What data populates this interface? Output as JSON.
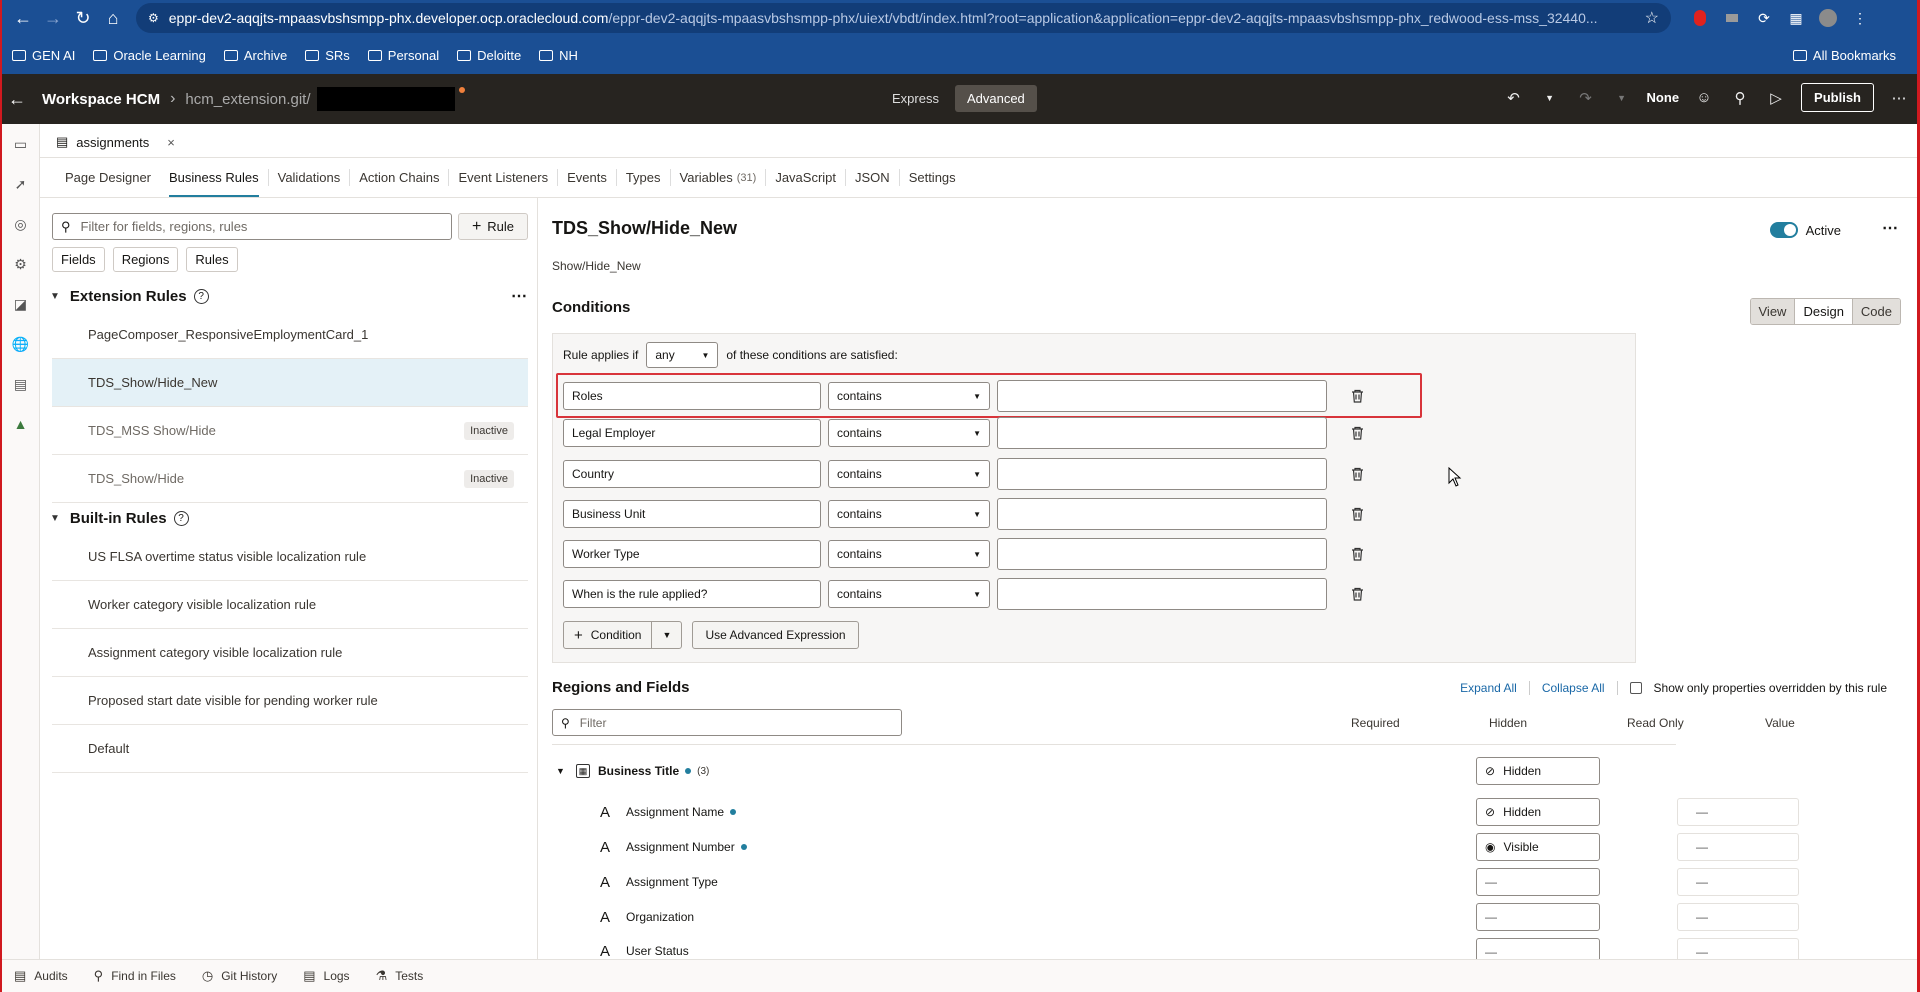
{
  "browser": {
    "url_domain": "eppr-dev2-aqqjts-mpaasvbshsmpp-phx.developer.ocp.oraclecloud.com",
    "url_path": "/eppr-dev2-aqqjts-mpaasvbshsmpp-phx/uiext/vbdt/index.html?root=application&application=eppr-dev2-aqqjts-mpaasvbshsmpp-phx_redwood-ess-mss_32440...",
    "bookmarks": [
      "GEN AI",
      "Oracle Learning",
      "Archive",
      "SRs",
      "Personal",
      "Deloitte",
      "NH"
    ],
    "all_bookmarks": "All Bookmarks"
  },
  "header": {
    "workspace": "Workspace HCM",
    "repo": "hcm_extension.git/",
    "modes": [
      "Express",
      "Advanced"
    ],
    "active_mode": "Advanced",
    "none_label": "None",
    "publish_label": "Publish"
  },
  "file_tab": {
    "label": "assignments",
    "close": "×"
  },
  "sub_tabs": [
    {
      "label": "Page Designer"
    },
    {
      "label": "Business Rules"
    },
    {
      "label": "Validations"
    },
    {
      "label": "Action Chains"
    },
    {
      "label": "Event Listeners"
    },
    {
      "label": "Events"
    },
    {
      "label": "Types"
    },
    {
      "label": "Variables",
      "count": "(31)"
    },
    {
      "label": "JavaScript"
    },
    {
      "label": "JSON"
    },
    {
      "label": "Settings"
    }
  ],
  "left": {
    "search_placeholder": "Filter for fields, regions, rules",
    "rule_button": "Rule",
    "chips": [
      "Fields",
      "Regions",
      "Rules"
    ],
    "extension_title": "Extension Rules",
    "extension_rules": [
      {
        "name": "PageComposer_ResponsiveEmploymentCard_1",
        "badge": ""
      },
      {
        "name": "TDS_Show/Hide_New",
        "badge": ""
      },
      {
        "name": "TDS_MSS Show/Hide",
        "badge": "Inactive"
      },
      {
        "name": "TDS_Show/Hide",
        "badge": "Inactive"
      }
    ],
    "builtin_title": "Built-in Rules",
    "builtin_rules": [
      "US FLSA overtime status visible localization rule",
      "Worker category visible localization rule",
      "Assignment category visible localization rule",
      "Proposed start date visible for pending worker rule",
      "Default"
    ]
  },
  "rule": {
    "title": "TDS_Show/Hide_New",
    "description": "Show/Hide_New",
    "active_label": "Active",
    "conditions_title": "Conditions",
    "view_modes": [
      "View",
      "Design",
      "Code"
    ],
    "applies_prefix": "Rule applies if",
    "applies_value": "any",
    "applies_suffix": "of these conditions are satisfied:",
    "conditions": [
      {
        "field": "Roles",
        "operator": "contains",
        "value": ""
      },
      {
        "field": "Legal Employer",
        "operator": "contains",
        "value": ""
      },
      {
        "field": "Country",
        "operator": "contains",
        "value": ""
      },
      {
        "field": "Business Unit",
        "operator": "contains",
        "value": ""
      },
      {
        "field": "Worker Type",
        "operator": "contains",
        "value": ""
      },
      {
        "field": "When is the rule applied?",
        "operator": "contains",
        "value": ""
      }
    ],
    "condition_button": "Condition",
    "advanced_button": "Use Advanced Expression"
  },
  "regions": {
    "title": "Regions and Fields",
    "expand_all": "Expand All",
    "collapse_all": "Collapse All",
    "override_label": "Show only properties overridden by this rule",
    "filter_placeholder": "Filter",
    "columns": [
      "Required",
      "Hidden",
      "Read Only",
      "Value"
    ],
    "group": {
      "name": "Business Title",
      "count": "(3)",
      "hidden": "Hidden"
    },
    "fields": [
      {
        "name": "Assignment Name",
        "dot": true,
        "hidden": "Hidden",
        "value": "—"
      },
      {
        "name": "Assignment Number",
        "dot": true,
        "hidden": "Visible",
        "value": "—"
      },
      {
        "name": "Assignment Type",
        "dot": false,
        "hidden": "—",
        "value": "—"
      },
      {
        "name": "Organization",
        "dot": false,
        "hidden": "—",
        "value": "—"
      },
      {
        "name": "User Status",
        "dot": false,
        "hidden": "—",
        "value": "—"
      }
    ]
  },
  "bottom": [
    "Audits",
    "Find in Files",
    "Git History",
    "Logs",
    "Tests"
  ]
}
